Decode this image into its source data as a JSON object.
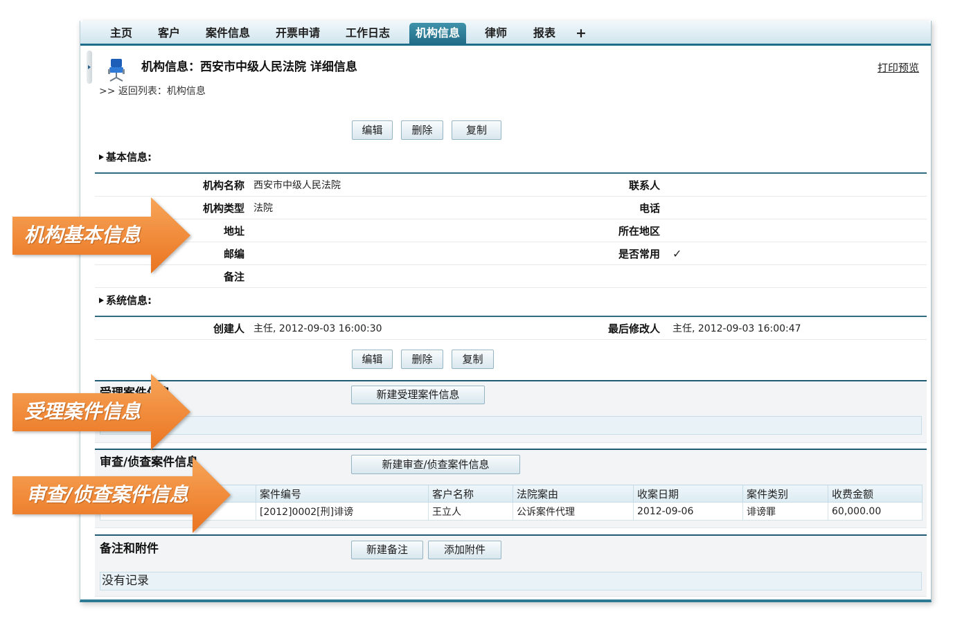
{
  "colors": {
    "accent": "#2e7d97",
    "tab_bar_line": "#1d6d8a",
    "callout_orange": "#f08a2e",
    "panel_blue": "#e8f2f7",
    "section_bg": "#f3f4f5"
  },
  "icons": {
    "institution": "chair-icon",
    "collapse_handle": "triangle-right-icon",
    "section_toggle": "triangle-right-icon",
    "callout": "orange-arrow-icon"
  },
  "tabs": [
    {
      "label": "主页",
      "active": false
    },
    {
      "label": "客户",
      "active": false
    },
    {
      "label": "案件信息",
      "active": false
    },
    {
      "label": "开票申请",
      "active": false
    },
    {
      "label": "工作日志",
      "active": false
    },
    {
      "label": "机构信息",
      "active": true
    },
    {
      "label": "律师",
      "active": false
    },
    {
      "label": "报表",
      "active": false
    }
  ],
  "tab_add_label": "+",
  "header": {
    "title": "机构信息：西安市中级人民法院 详细信息",
    "print_preview": "打印预览",
    "back_prefix": ">>",
    "back_link": "返回列表：机构信息"
  },
  "actions": {
    "edit": "编辑",
    "delete": "删除",
    "copy": "复制"
  },
  "basic_info": {
    "heading": "基本信息:",
    "rows": [
      {
        "left_label": "机构名称",
        "left_value": "西安市中级人民法院",
        "right_label": "联系人"
      },
      {
        "left_label": "机构类型",
        "left_value": "法院",
        "right_label": "电话"
      },
      {
        "left_label": "地址",
        "right_label": "所在地区"
      },
      {
        "left_label": "邮编",
        "right_label": "是否常用",
        "right_value": "✓"
      },
      {
        "left_label": "备注"
      }
    ]
  },
  "system_info": {
    "heading": "系统信息:",
    "created_by_label": "创建人",
    "created_by": "主任, 2012-09-03 16:00:30",
    "modified_by_label": "最后修改人",
    "modified_by": "主任, 2012-09-03 16:00:47"
  },
  "accepted_cases": {
    "title": "受理案件信息",
    "new_button": "新建受理案件信息"
  },
  "review_cases": {
    "title": "审查/侦查案件信息",
    "new_button": "新建审查/侦查案件信息",
    "columns": [
      "案件编号",
      "客户名称",
      "法院案由",
      "收案日期",
      "案件类别",
      "收费金额"
    ],
    "rows": [
      [
        "[2012]0002[刑]诽谤",
        "王立人",
        "公诉案件代理",
        "2012-09-06",
        "诽谤罪",
        "60,000.00"
      ]
    ]
  },
  "notes": {
    "title": "备注和附件",
    "new_note_button": "新建备注",
    "add_attachment_button": "添加附件",
    "empty_text": "没有记录"
  },
  "callouts": {
    "basic": "机构基本信息",
    "accepted": "受理案件信息",
    "review": "审查/侦查案件信息"
  }
}
